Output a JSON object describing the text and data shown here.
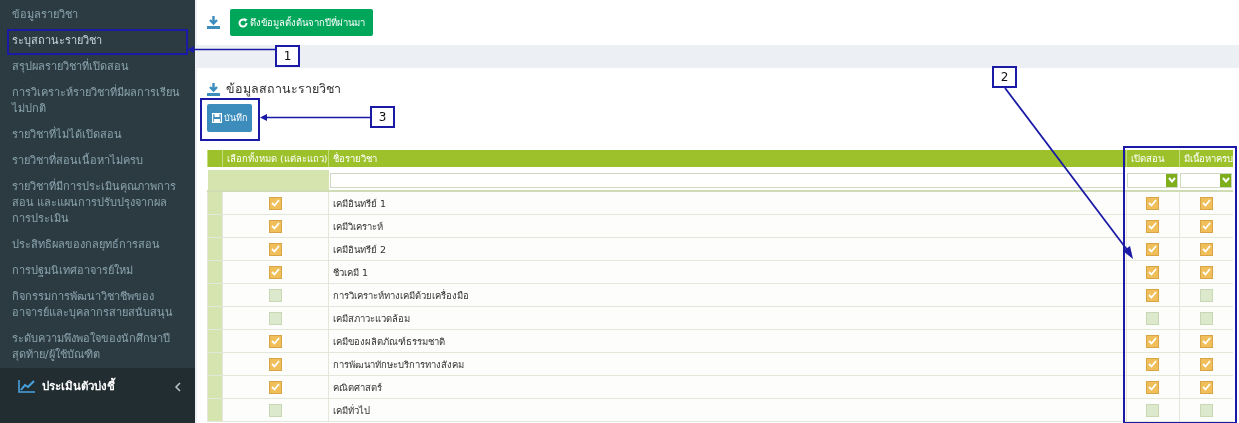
{
  "sidebar": {
    "items": [
      {
        "label": "ข้อมูลรายวิชา",
        "selected": false
      },
      {
        "label": "ระบุสถานะรายวิชา",
        "selected": true
      },
      {
        "label": "สรุปผลรายวิชาที่เปิดสอน",
        "selected": false
      },
      {
        "label": "การวิเคราะห์รายวิชาที่มีผลการเรียนไม่ปกติ",
        "selected": false
      },
      {
        "label": "รายวิชาที่ไม่ได้เปิดสอน",
        "selected": false
      },
      {
        "label": "รายวิชาที่สอนเนื้อหาไม่ครบ",
        "selected": false
      },
      {
        "label": "รายวิชาที่มีการประเมินคุณภาพการสอน และแผนการปรับปรุงจากผลการประเมิน",
        "selected": false
      },
      {
        "label": "ประสิทธิผลของกลยุทธ์การสอน",
        "selected": false
      },
      {
        "label": "การปฐมนิเทศอาจารย์ใหม่",
        "selected": false
      },
      {
        "label": "กิจกรรมการพัฒนาวิชาชีพของอาจารย์และบุคลากรสายสนับสนุน",
        "selected": false
      },
      {
        "label": "ระดับความพึงพอใจของนักศึกษาปีสุดท้าย/ผู้ใช้บัณฑิต",
        "selected": false
      }
    ],
    "section": {
      "label": "ประเมินตัวบ่งชี้"
    }
  },
  "toolbar": {
    "button": "ดึงข้อมูลตั้งต้นจากปีที่ผ่านมา"
  },
  "section": {
    "title": "ข้อมูลสถานะรายวิชา",
    "save_button": "บันทึก"
  },
  "table": {
    "columns": [
      "เลือกทั้งหมด (แต่ละแถว)",
      "ชื่อรายวิชา",
      "เปิดสอน",
      "มีเนื้อหาครบ"
    ],
    "rows": [
      {
        "select": true,
        "name": "เคมีอินทรีย์ 1",
        "open": true,
        "complete": true
      },
      {
        "select": true,
        "name": "เคมีวิเคราะห์",
        "open": true,
        "complete": true
      },
      {
        "select": true,
        "name": "เคมีอินทรีย์ 2",
        "open": true,
        "complete": true
      },
      {
        "select": true,
        "name": "ชีวเคมี 1",
        "open": true,
        "complete": true
      },
      {
        "select": false,
        "name": "การวิเคราะห์ทางเคมีด้วยเครื่องมือ",
        "open": true,
        "complete": false
      },
      {
        "select": false,
        "name": "เคมีสภาวะแวดล้อม",
        "open": false,
        "complete": false
      },
      {
        "select": true,
        "name": "เคมีของผลิตภัณฑ์ธรรมชาติ",
        "open": true,
        "complete": true
      },
      {
        "select": true,
        "name": "การพัฒนาทักษะบริการทางสังคม",
        "open": true,
        "complete": true
      },
      {
        "select": true,
        "name": "คณิตศาสตร์",
        "open": true,
        "complete": true
      },
      {
        "select": false,
        "name": "เคมีทั่วไป",
        "open": false,
        "complete": false
      }
    ]
  },
  "callouts": [
    {
      "label": "1"
    },
    {
      "label": "2"
    },
    {
      "label": "3"
    }
  ]
}
